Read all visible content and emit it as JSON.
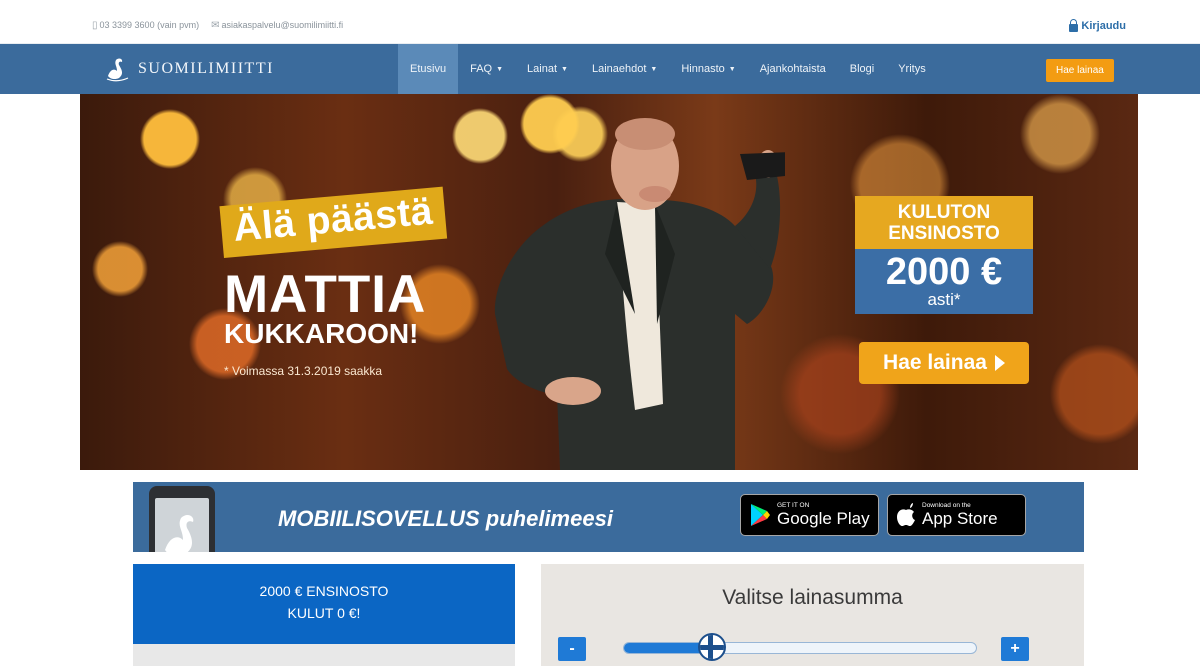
{
  "topbar": {
    "phone": "03 3399 3600 (vain pvm)",
    "email": "asiakaspalvelu@suomilimiitti.fi",
    "login_label": "Kirjaudu"
  },
  "nav": {
    "logo_text": "SUOMILIMIITTI",
    "items": [
      {
        "label": "Etusivu",
        "caret": false
      },
      {
        "label": "FAQ",
        "caret": true
      },
      {
        "label": "Lainat",
        "caret": true
      },
      {
        "label": "Lainaehdot",
        "caret": true
      },
      {
        "label": "Hinnasto",
        "caret": true
      },
      {
        "label": "Ajankohtaista",
        "caret": false
      },
      {
        "label": "Blogi",
        "caret": false
      },
      {
        "label": "Yritys",
        "caret": false
      }
    ],
    "cta_label": "Hae lainaa"
  },
  "hero": {
    "line1": "Älä päästä",
    "line2": "MATTIA",
    "line3": "KUKKAROON!",
    "note": "* Voimassa 31.3.2019 saakka",
    "offer_title": "KULUTON ENSINOSTO",
    "offer_amount": "2000 €",
    "offer_suffix": "asti*",
    "cta_label": "Hae lainaa"
  },
  "app_banner": {
    "text": "MOBIILISOVELLUS puhelimeesi",
    "google_small": "GET IT ON",
    "google_big": "Google Play",
    "apple_small": "Download on the",
    "apple_big": "App Store"
  },
  "promo": {
    "line1": "2000 € ENSINOSTO",
    "line2": "KULUT 0 €!"
  },
  "calculator": {
    "title": "Valitse lainasumma",
    "minus_label": "-",
    "plus_label": "+",
    "slider_fraction": 0.25
  }
}
